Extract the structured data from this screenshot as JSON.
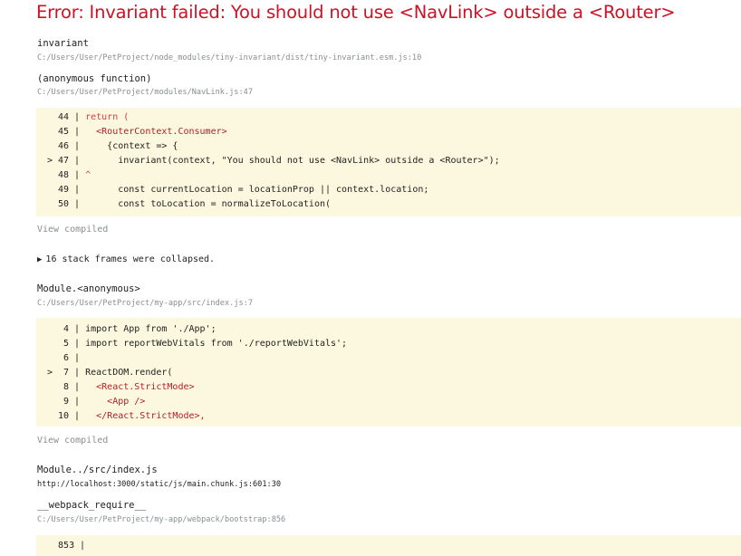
{
  "title": "Error: Invariant failed: You should not use <NavLink> outside a <Router>",
  "frames": [
    {
      "fn": "invariant",
      "path": "C:/Users/User/PetProject/node_modules/tiny-invariant/dist/tiny-invariant.esm.js:10"
    },
    {
      "fn": "(anonymous function)",
      "path": "C:/Users/User/PetProject/modules/NavLink.js:47"
    },
    {
      "fn": "Module.<anonymous>",
      "path": "C:/Users/User/PetProject/my-app/src/index.js:7"
    },
    {
      "fn": "Module../src/index.js",
      "path": "http://localhost:3000/static/js/main.chunk.js:601:30"
    },
    {
      "fn": "__webpack_require__",
      "path": "C:/Users/User/PetProject/my-app/webpack/bootstrap:856"
    }
  ],
  "code_block_1": {
    "lines": [
      {
        "marker": "",
        "num": "44",
        "code": "return ("
      },
      {
        "marker": "",
        "num": "45",
        "code": "  <RouterContext.Consumer>"
      },
      {
        "marker": "",
        "num": "46",
        "code": "    {context => {"
      },
      {
        "marker": ">",
        "num": "47",
        "code": "      invariant(context, \"You should not use <NavLink> outside a <Router>\");"
      },
      {
        "marker": "",
        "num": "48",
        "code": "^"
      },
      {
        "marker": "",
        "num": "49",
        "code": "      const currentLocation = locationProp || context.location;"
      },
      {
        "marker": "",
        "num": "50",
        "code": "      const toLocation = normalizeToLocation("
      }
    ]
  },
  "code_block_2": {
    "lines": [
      {
        "marker": "",
        "num": "4",
        "code": "import App from './App';"
      },
      {
        "marker": "",
        "num": "5",
        "code": "import reportWebVitals from './reportWebVitals';"
      },
      {
        "marker": "",
        "num": "6",
        "code": ""
      },
      {
        "marker": ">",
        "num": "7",
        "code": "ReactDOM.render("
      },
      {
        "marker": "",
        "num": "8",
        "code": "  <React.StrictMode>"
      },
      {
        "marker": "",
        "num": "9",
        "code": "    <App />"
      },
      {
        "marker": "",
        "num": "10",
        "code": "  </React.StrictMode>,"
      }
    ]
  },
  "code_block_3": {
    "lines": [
      {
        "marker": "",
        "num": "853",
        "code": ""
      }
    ]
  },
  "view_compiled_label": "View compiled",
  "collapsed": {
    "icon": "triangle-right-icon",
    "text": "16 stack frames were collapsed."
  },
  "colors": {
    "error_red": "#ce1126",
    "code_bg": "#fcf8df",
    "path_gray": "#878e91"
  }
}
